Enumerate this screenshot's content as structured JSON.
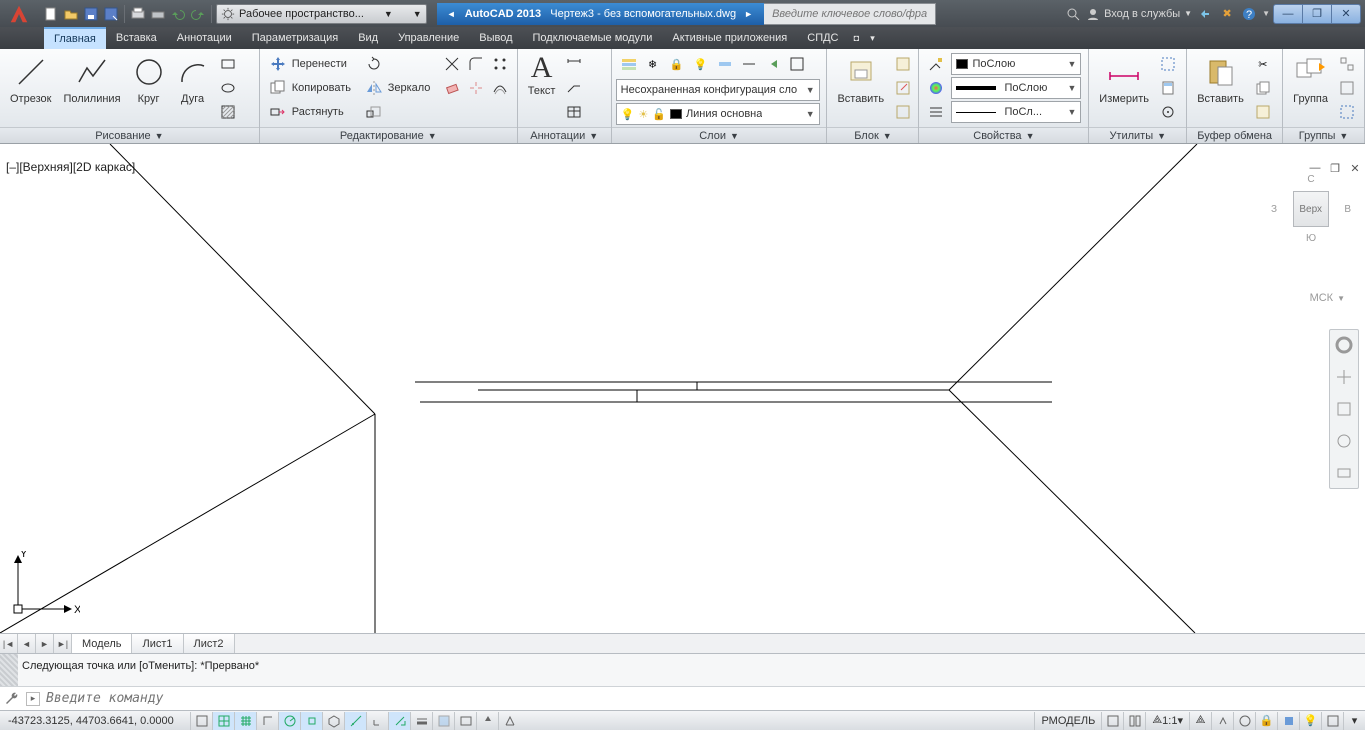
{
  "title": {
    "app": "AutoCAD 2013",
    "doc": "Чертеж3 - без вспомогательных.dwg"
  },
  "workspace_combo": "Рабочее пространство...",
  "search_placeholder": "Введите ключевое слово/фразу",
  "signin": "Вход в службы",
  "menu": {
    "items": [
      "Главная",
      "Вставка",
      "Аннотации",
      "Параметризация",
      "Вид",
      "Управление",
      "Вывод",
      "Подключаемые модули",
      "Активные приложения",
      "СПДС"
    ],
    "active": 0
  },
  "ribbon": {
    "draw": {
      "title": "Рисование",
      "items": [
        "Отрезок",
        "Полилиния",
        "Круг",
        "Дуга"
      ]
    },
    "modify": {
      "title": "Редактирование",
      "move": "Перенести",
      "copy": "Копировать",
      "stretch": "Растянуть",
      "rotate": "",
      "mirror": "Зеркало",
      "scale": ""
    },
    "annot": {
      "title": "Аннотации",
      "text": "Текст"
    },
    "layers": {
      "title": "Слои",
      "combo": "Несохраненная конфигурация сло",
      "current": "Линия основна"
    },
    "block": {
      "title": "Блок",
      "insert": "Вставить"
    },
    "props": {
      "title": "Свойства",
      "layer": "ПоСлою",
      "color": "ПоСлою",
      "ltype": "ПоСл..."
    },
    "util": {
      "title": "Утилиты",
      "measure": "Измерить"
    },
    "clip": {
      "title": "Буфер обмена",
      "paste": "Вставить"
    },
    "group": {
      "title": "Группы",
      "group": "Группа"
    }
  },
  "viewport_label": "[–][Верхняя][2D каркас]",
  "viewcube": {
    "n": "С",
    "e": "В",
    "s": "Ю",
    "w": "З",
    "face": "Верх",
    "wcs": "МСК"
  },
  "tabs": {
    "items": [
      "Модель",
      "Лист1",
      "Лист2"
    ],
    "active": 0
  },
  "cmd": {
    "history": "Следующая точка или [оТменить]: *Прервано*",
    "placeholder": "Введите команду"
  },
  "status": {
    "coords": "-43723.3125, 44703.6641, 0.0000",
    "model": "РМОДЕЛЬ",
    "scale": "1:1"
  }
}
